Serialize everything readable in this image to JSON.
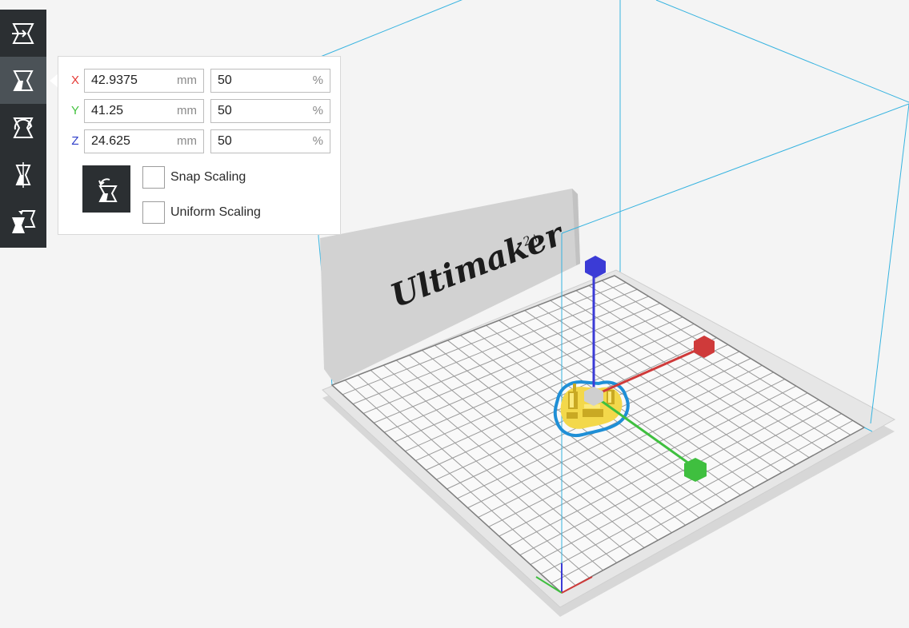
{
  "scene": {
    "printer_logo": "Ultimaker",
    "printer_logo_superscript": "2+"
  },
  "toolbar": {
    "tools": [
      {
        "name": "translate",
        "icon": "move-tool-icon",
        "active": false
      },
      {
        "name": "scale",
        "icon": "scale-tool-icon",
        "active": true
      },
      {
        "name": "rotate",
        "icon": "rotate-tool-icon",
        "active": false
      },
      {
        "name": "mirror",
        "icon": "mirror-tool-icon",
        "active": false
      },
      {
        "name": "per-model-settings",
        "icon": "per-model-settings-icon",
        "active": false
      }
    ]
  },
  "scale_panel": {
    "rows": [
      {
        "axis": "X",
        "color": "#e53935",
        "size": "42.9375",
        "size_unit": "mm",
        "percent": "50",
        "percent_unit": "%"
      },
      {
        "axis": "Y",
        "color": "#43c23e",
        "size": "41.25",
        "size_unit": "mm",
        "percent": "50",
        "percent_unit": "%"
      },
      {
        "axis": "Z",
        "color": "#2d3cc9",
        "size": "24.625",
        "size_unit": "mm",
        "percent": "50",
        "percent_unit": "%"
      }
    ],
    "reset_icon": "reset-scale-icon",
    "snap_scaling_label": "Snap Scaling",
    "snap_scaling_checked": false,
    "uniform_scaling_label": "Uniform Scaling",
    "uniform_scaling_checked": false
  },
  "colors": {
    "toolbar_bg": "#2b2f32",
    "toolbar_active": "#4b5257",
    "build_volume_line": "#36b3e0",
    "model_fill": "#f3d84b",
    "model_outline": "#1f8fd6",
    "axis_x": "#cf3a3a",
    "axis_y": "#3fbf3f",
    "axis_z": "#3b3bd6"
  }
}
